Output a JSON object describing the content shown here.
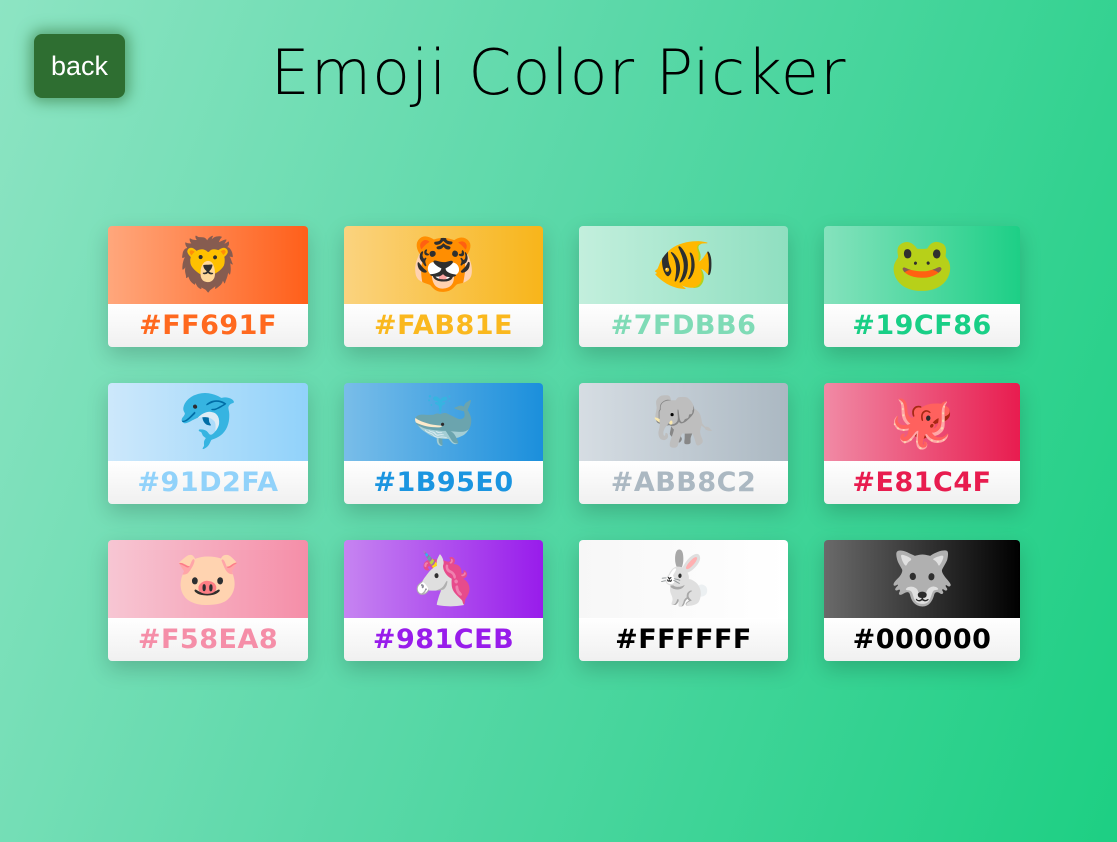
{
  "header": {
    "back_label": "back",
    "title": "Emoji Color Picker"
  },
  "cards": [
    {
      "emoji": "🦁",
      "icon": "lion-face-icon",
      "hex": "#FF691F",
      "color": "#FF691F",
      "swatch_from": "#ffa77c",
      "swatch_to": "#ff5f1a"
    },
    {
      "emoji": "🐯",
      "icon": "tiger-face-icon",
      "hex": "#FAB81E",
      "color": "#FAB81E",
      "swatch_from": "#fad37f",
      "swatch_to": "#f8b51a"
    },
    {
      "emoji": "🐠",
      "icon": "tropical-fish-icon",
      "hex": "#7FDBB6",
      "color": "#7FDBB6",
      "swatch_from": "#c3efdd",
      "swatch_to": "#8fdfc0"
    },
    {
      "emoji": "🐸",
      "icon": "frog-face-icon",
      "hex": "#19CF86",
      "color": "#19CF86",
      "swatch_from": "#85e2bd",
      "swatch_to": "#1dcf86"
    },
    {
      "emoji": "🐬",
      "icon": "dolphin-icon",
      "hex": "#91D2FA",
      "color": "#91D2FA",
      "swatch_from": "#cde8fb",
      "swatch_to": "#91d2fa"
    },
    {
      "emoji": "🐳",
      "icon": "spouting-whale-icon",
      "hex": "#1B95E0",
      "color": "#1B95E0",
      "swatch_from": "#79bde9",
      "swatch_to": "#1b8fdc"
    },
    {
      "emoji": "🐘",
      "icon": "elephant-icon",
      "hex": "#ABB8C2",
      "color": "#ABB8C2",
      "swatch_from": "#d6dde3",
      "swatch_to": "#abb8c2"
    },
    {
      "emoji": "🐙",
      "icon": "octopus-icon",
      "hex": "#E81C4F",
      "color": "#E81C4F",
      "swatch_from": "#f08aa5",
      "swatch_to": "#e81c4f"
    },
    {
      "emoji": "🐷",
      "icon": "pig-face-icon",
      "hex": "#F58EA8",
      "color": "#F58EA8",
      "swatch_from": "#f7c6d3",
      "swatch_to": "#f58ea8"
    },
    {
      "emoji": "🦄",
      "icon": "unicorn-face-icon",
      "hex": "#981CEB",
      "color": "#981CEB",
      "swatch_from": "#c684f1",
      "swatch_to": "#981ceb"
    },
    {
      "emoji": "🐇",
      "icon": "rabbit-icon",
      "hex": "#FFFFFF",
      "color": "#000000",
      "swatch_from": "#f7f7f7",
      "swatch_to": "#ffffff"
    },
    {
      "emoji": "🐺",
      "icon": "wolf-face-icon",
      "hex": "#000000",
      "color": "#000000",
      "swatch_from": "#6a6a6a",
      "swatch_to": "#000000"
    }
  ]
}
